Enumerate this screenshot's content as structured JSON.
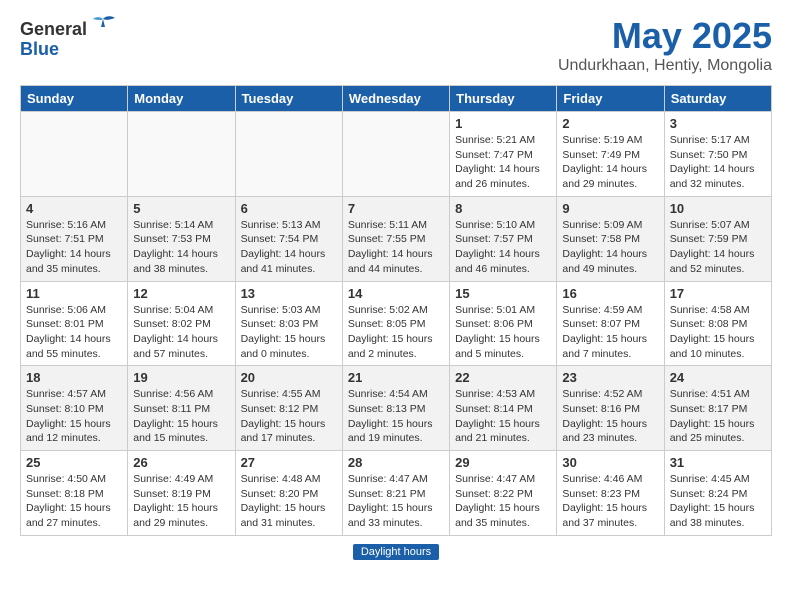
{
  "header": {
    "logo_general": "General",
    "logo_blue": "Blue",
    "month_title": "May 2025",
    "location": "Undurkhaan, Hentiy, Mongolia"
  },
  "days_of_week": [
    "Sunday",
    "Monday",
    "Tuesday",
    "Wednesday",
    "Thursday",
    "Friday",
    "Saturday"
  ],
  "footer": {
    "label": "Daylight hours"
  },
  "weeks": [
    [
      {
        "day": "",
        "info": ""
      },
      {
        "day": "",
        "info": ""
      },
      {
        "day": "",
        "info": ""
      },
      {
        "day": "",
        "info": ""
      },
      {
        "day": "1",
        "info": "Sunrise: 5:21 AM\nSunset: 7:47 PM\nDaylight: 14 hours and 26 minutes."
      },
      {
        "day": "2",
        "info": "Sunrise: 5:19 AM\nSunset: 7:49 PM\nDaylight: 14 hours and 29 minutes."
      },
      {
        "day": "3",
        "info": "Sunrise: 5:17 AM\nSunset: 7:50 PM\nDaylight: 14 hours and 32 minutes."
      }
    ],
    [
      {
        "day": "4",
        "info": "Sunrise: 5:16 AM\nSunset: 7:51 PM\nDaylight: 14 hours and 35 minutes."
      },
      {
        "day": "5",
        "info": "Sunrise: 5:14 AM\nSunset: 7:53 PM\nDaylight: 14 hours and 38 minutes."
      },
      {
        "day": "6",
        "info": "Sunrise: 5:13 AM\nSunset: 7:54 PM\nDaylight: 14 hours and 41 minutes."
      },
      {
        "day": "7",
        "info": "Sunrise: 5:11 AM\nSunset: 7:55 PM\nDaylight: 14 hours and 44 minutes."
      },
      {
        "day": "8",
        "info": "Sunrise: 5:10 AM\nSunset: 7:57 PM\nDaylight: 14 hours and 46 minutes."
      },
      {
        "day": "9",
        "info": "Sunrise: 5:09 AM\nSunset: 7:58 PM\nDaylight: 14 hours and 49 minutes."
      },
      {
        "day": "10",
        "info": "Sunrise: 5:07 AM\nSunset: 7:59 PM\nDaylight: 14 hours and 52 minutes."
      }
    ],
    [
      {
        "day": "11",
        "info": "Sunrise: 5:06 AM\nSunset: 8:01 PM\nDaylight: 14 hours and 55 minutes."
      },
      {
        "day": "12",
        "info": "Sunrise: 5:04 AM\nSunset: 8:02 PM\nDaylight: 14 hours and 57 minutes."
      },
      {
        "day": "13",
        "info": "Sunrise: 5:03 AM\nSunset: 8:03 PM\nDaylight: 15 hours and 0 minutes."
      },
      {
        "day": "14",
        "info": "Sunrise: 5:02 AM\nSunset: 8:05 PM\nDaylight: 15 hours and 2 minutes."
      },
      {
        "day": "15",
        "info": "Sunrise: 5:01 AM\nSunset: 8:06 PM\nDaylight: 15 hours and 5 minutes."
      },
      {
        "day": "16",
        "info": "Sunrise: 4:59 AM\nSunset: 8:07 PM\nDaylight: 15 hours and 7 minutes."
      },
      {
        "day": "17",
        "info": "Sunrise: 4:58 AM\nSunset: 8:08 PM\nDaylight: 15 hours and 10 minutes."
      }
    ],
    [
      {
        "day": "18",
        "info": "Sunrise: 4:57 AM\nSunset: 8:10 PM\nDaylight: 15 hours and 12 minutes."
      },
      {
        "day": "19",
        "info": "Sunrise: 4:56 AM\nSunset: 8:11 PM\nDaylight: 15 hours and 15 minutes."
      },
      {
        "day": "20",
        "info": "Sunrise: 4:55 AM\nSunset: 8:12 PM\nDaylight: 15 hours and 17 minutes."
      },
      {
        "day": "21",
        "info": "Sunrise: 4:54 AM\nSunset: 8:13 PM\nDaylight: 15 hours and 19 minutes."
      },
      {
        "day": "22",
        "info": "Sunrise: 4:53 AM\nSunset: 8:14 PM\nDaylight: 15 hours and 21 minutes."
      },
      {
        "day": "23",
        "info": "Sunrise: 4:52 AM\nSunset: 8:16 PM\nDaylight: 15 hours and 23 minutes."
      },
      {
        "day": "24",
        "info": "Sunrise: 4:51 AM\nSunset: 8:17 PM\nDaylight: 15 hours and 25 minutes."
      }
    ],
    [
      {
        "day": "25",
        "info": "Sunrise: 4:50 AM\nSunset: 8:18 PM\nDaylight: 15 hours and 27 minutes."
      },
      {
        "day": "26",
        "info": "Sunrise: 4:49 AM\nSunset: 8:19 PM\nDaylight: 15 hours and 29 minutes."
      },
      {
        "day": "27",
        "info": "Sunrise: 4:48 AM\nSunset: 8:20 PM\nDaylight: 15 hours and 31 minutes."
      },
      {
        "day": "28",
        "info": "Sunrise: 4:47 AM\nSunset: 8:21 PM\nDaylight: 15 hours and 33 minutes."
      },
      {
        "day": "29",
        "info": "Sunrise: 4:47 AM\nSunset: 8:22 PM\nDaylight: 15 hours and 35 minutes."
      },
      {
        "day": "30",
        "info": "Sunrise: 4:46 AM\nSunset: 8:23 PM\nDaylight: 15 hours and 37 minutes."
      },
      {
        "day": "31",
        "info": "Sunrise: 4:45 AM\nSunset: 8:24 PM\nDaylight: 15 hours and 38 minutes."
      }
    ]
  ]
}
